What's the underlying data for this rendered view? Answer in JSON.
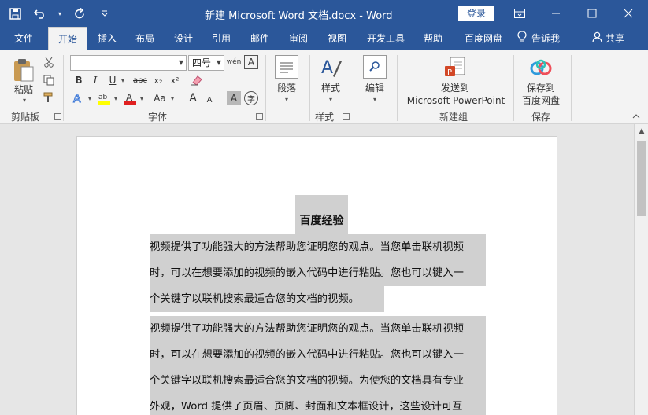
{
  "titlebar": {
    "title": "新建 Microsoft Word 文档.docx  -  Word",
    "login": "登录",
    "qat": {
      "save_icon": "save-icon",
      "undo_icon": "undo-icon",
      "redo_icon": "redo-icon",
      "customize_icon": "customize-qat-icon"
    },
    "controls": {
      "ribbon_display_icon": "ribbon-display-options-icon",
      "minimize_icon": "minimize-icon",
      "maximize_icon": "maximize-icon",
      "close_icon": "close-icon"
    }
  },
  "tabs": [
    "文件",
    "开始",
    "插入",
    "布局",
    "设计",
    "引用",
    "邮件",
    "审阅",
    "视图",
    "开发工具",
    "帮助",
    "百度网盘"
  ],
  "active_tab": "开始",
  "tellme": "告诉我",
  "share": "共享",
  "ribbon": {
    "clipboard": {
      "paste": "粘贴",
      "label": "剪贴板"
    },
    "font": {
      "font_name": "",
      "font_size": "四号",
      "label": "字体",
      "buttons": {
        "bold": "B",
        "italic": "I",
        "underline": "U",
        "strike": "abc",
        "subscript": "x₂",
        "superscript": "x²",
        "case": "Aa",
        "grow": "A",
        "shrink": "A",
        "shade": "A",
        "phonetic": "wén",
        "border": "A",
        "enclose": "字"
      }
    },
    "paragraph": {
      "label": "段落",
      "group_label": "段落"
    },
    "styles": {
      "label": "样式",
      "group_label": "样式"
    },
    "editing": {
      "label": "编辑"
    },
    "newgroup": {
      "label_line1": "发送到",
      "label_line2": "Microsoft PowerPoint",
      "group_label": "新建组"
    },
    "save": {
      "label_line1": "保存到",
      "label_line2": "百度网盘",
      "group_label": "保存"
    }
  },
  "document": {
    "title": "百度经验",
    "para1": [
      "视频提供了功能强大的方法帮助您证明您的观点。当您单击联机视频",
      "时，可以在想要添加的视频的嵌入代码中进行粘贴。您也可以键入一",
      "个关键字以联机搜索最适合您的文档的视频。"
    ],
    "para2": [
      "视频提供了功能强大的方法帮助您证明您的观点。当您单击联机视频",
      "时，可以在想要添加的视频的嵌入代码中进行粘贴。您也可以键入一",
      "个关键字以联机搜索最适合您的文档的视频。为使您的文档具有专业",
      "外观，Word 提供了页眉、页脚、封面和文本框设计，这些设计可互"
    ]
  }
}
